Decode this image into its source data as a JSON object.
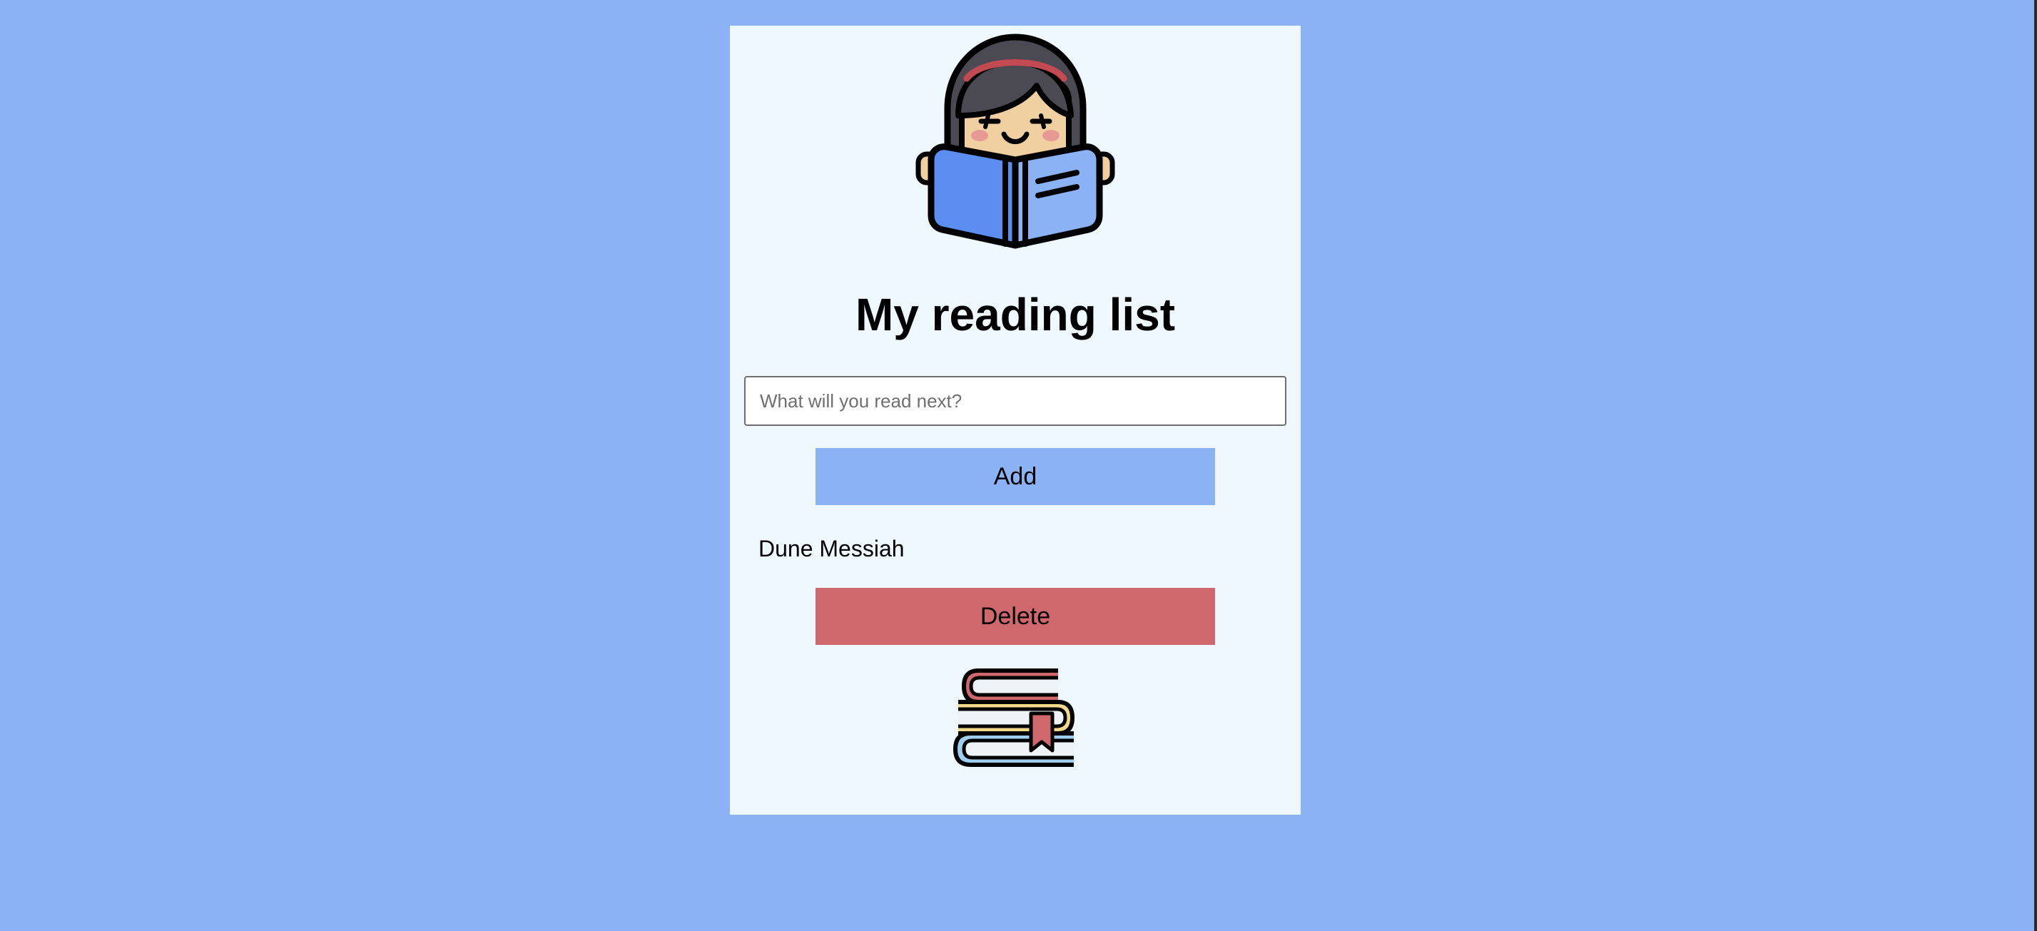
{
  "app": {
    "title": "My reading list"
  },
  "form": {
    "input_value": "",
    "input_placeholder": "What will you read next?",
    "add_label": "Add"
  },
  "list": {
    "items": [
      {
        "title": "Dune Messiah",
        "delete_label": "Delete"
      }
    ]
  },
  "illustrations": {
    "top": "reader-girl-with-book-icon",
    "bottom": "stacked-books-with-bookmark-icon"
  },
  "colors": {
    "page_background": "#8ab2f5",
    "card_background": "#eff7ff",
    "add_button": "#8ab2f5",
    "delete_button": "#cf686c",
    "book_blue": "#5b8ef0"
  }
}
